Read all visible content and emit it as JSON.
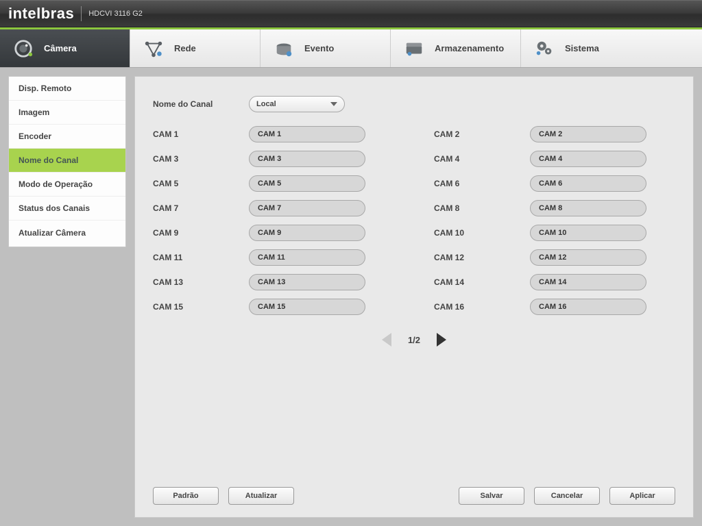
{
  "header": {
    "brand": "intelbras",
    "product": "HDCVI 3116 G2"
  },
  "topnav": {
    "items": [
      {
        "label": "Câmera",
        "icon": "lens-icon"
      },
      {
        "label": "Rede",
        "icon": "network-icon"
      },
      {
        "label": "Evento",
        "icon": "event-icon"
      },
      {
        "label": "Armazenamento",
        "icon": "storage-icon"
      },
      {
        "label": "Sistema",
        "icon": "system-icon"
      }
    ],
    "active_index": 0
  },
  "sidebar": {
    "items": [
      {
        "label": "Disp. Remoto"
      },
      {
        "label": "Imagem"
      },
      {
        "label": "Encoder"
      },
      {
        "label": "Nome do Canal"
      },
      {
        "label": "Modo de Operação"
      },
      {
        "label": "Status dos Canais"
      },
      {
        "label": "Atualizar Câmera"
      }
    ],
    "active_index": 3
  },
  "form": {
    "selector_label": "Nome do Canal",
    "selector_value": "Local",
    "channels": [
      {
        "label": "CAM 1",
        "value": "CAM 1"
      },
      {
        "label": "CAM 2",
        "value": "CAM 2"
      },
      {
        "label": "CAM 3",
        "value": "CAM 3"
      },
      {
        "label": "CAM 4",
        "value": "CAM 4"
      },
      {
        "label": "CAM 5",
        "value": "CAM 5"
      },
      {
        "label": "CAM 6",
        "value": "CAM 6"
      },
      {
        "label": "CAM 7",
        "value": "CAM 7"
      },
      {
        "label": "CAM 8",
        "value": "CAM 8"
      },
      {
        "label": "CAM 9",
        "value": "CAM 9"
      },
      {
        "label": "CAM 10",
        "value": "CAM 10"
      },
      {
        "label": "CAM 11",
        "value": "CAM 11"
      },
      {
        "label": "CAM 12",
        "value": "CAM 12"
      },
      {
        "label": "CAM 13",
        "value": "CAM 13"
      },
      {
        "label": "CAM 14",
        "value": "CAM 14"
      },
      {
        "label": "CAM 15",
        "value": "CAM 15"
      },
      {
        "label": "CAM 16",
        "value": "CAM 16"
      }
    ],
    "pager": "1/2"
  },
  "buttons": {
    "default": "Padrão",
    "refresh": "Atualizar",
    "save": "Salvar",
    "cancel": "Cancelar",
    "apply": "Aplicar"
  }
}
